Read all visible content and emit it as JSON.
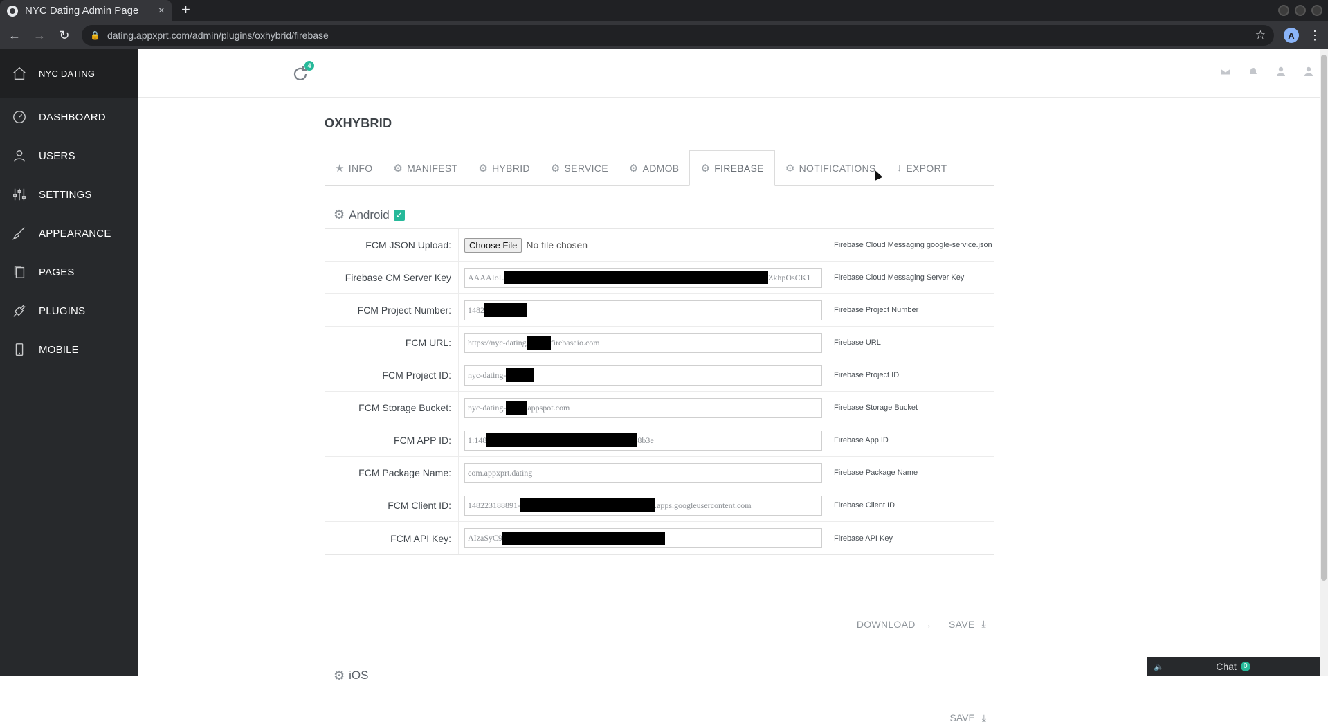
{
  "browser": {
    "tab_title": "NYC Dating Admin Page",
    "close_glyph": "×",
    "newtab_glyph": "+",
    "url": "dating.appxprt.com/admin/plugins/oxhybrid/firebase",
    "profile_initial": "A"
  },
  "sidebar": {
    "brand": "NYC DATING",
    "items": [
      {
        "label": "DASHBOARD",
        "icon": "dashboard-icon"
      },
      {
        "label": "USERS",
        "icon": "user-icon"
      },
      {
        "label": "SETTINGS",
        "icon": "sliders-icon"
      },
      {
        "label": "APPEARANCE",
        "icon": "brush-icon"
      },
      {
        "label": "PAGES",
        "icon": "pages-icon"
      },
      {
        "label": "PLUGINS",
        "icon": "plug-icon"
      },
      {
        "label": "MOBILE",
        "icon": "mobile-icon"
      }
    ]
  },
  "topbar": {
    "sync_badge": "4"
  },
  "page": {
    "title": "OXHYBRID",
    "tabs": [
      {
        "label": "INFO",
        "icon": "star-icon"
      },
      {
        "label": "MANIFEST",
        "icon": "gear-icon"
      },
      {
        "label": "HYBRID",
        "icon": "gear-icon"
      },
      {
        "label": "SERVICE",
        "icon": "gear-icon"
      },
      {
        "label": "ADMOB",
        "icon": "gear-icon"
      },
      {
        "label": "FIREBASE",
        "icon": "gear-icon",
        "active": true
      },
      {
        "label": "NOTIFICATIONS",
        "icon": "gear-icon"
      },
      {
        "label": "EXPORT",
        "icon": "download-arrow-icon"
      }
    ]
  },
  "android": {
    "title": "Android",
    "rows": [
      {
        "label": "FCM JSON Upload:",
        "file_button": "Choose File",
        "file_status": "No file chosen",
        "hint": "Firebase Cloud Messaging google-service.json"
      },
      {
        "label": "Firebase CM Server Key",
        "prefix": "AAAAIoL",
        "suffix": "ZkhpOsCK1",
        "hint": "Firebase Cloud Messaging Server Key"
      },
      {
        "label": "FCM Project Number:",
        "prefix": "1482",
        "suffix": "",
        "hint": "Firebase Project Number"
      },
      {
        "label": "FCM URL:",
        "prefix": "https://nyc-dating",
        "suffix": "firebaseio.com",
        "hint": "Firebase URL"
      },
      {
        "label": "FCM Project ID:",
        "prefix": "nyc-dating-",
        "suffix": "",
        "hint": "Firebase Project ID"
      },
      {
        "label": "FCM Storage Bucket:",
        "prefix": "nyc-dating-",
        "suffix": "appspot.com",
        "hint": "Firebase Storage Bucket"
      },
      {
        "label": "FCM APP ID:",
        "prefix": "1:148",
        "suffix": "8b3e",
        "hint": "Firebase App ID"
      },
      {
        "label": "FCM Package Name:",
        "prefix": "com.appxprt.dating",
        "suffix": "",
        "hint": "Firebase Package Name"
      },
      {
        "label": "FCM Client ID:",
        "prefix": "148223188891-",
        "suffix": ".apps.googleusercontent.com",
        "hint": "Firebase Client ID"
      },
      {
        "label": "FCM API Key:",
        "prefix": "AIzaSyC9",
        "suffix": "",
        "hint": "Firebase API Key"
      }
    ],
    "download_label": "DOWNLOAD",
    "save_label": "SAVE"
  },
  "ios": {
    "title": "iOS",
    "save_label": "SAVE"
  },
  "chat": {
    "label": "Chat",
    "count": "0"
  },
  "colors": {
    "sidebar_bg": "#27292c",
    "accent": "#26b99a"
  }
}
